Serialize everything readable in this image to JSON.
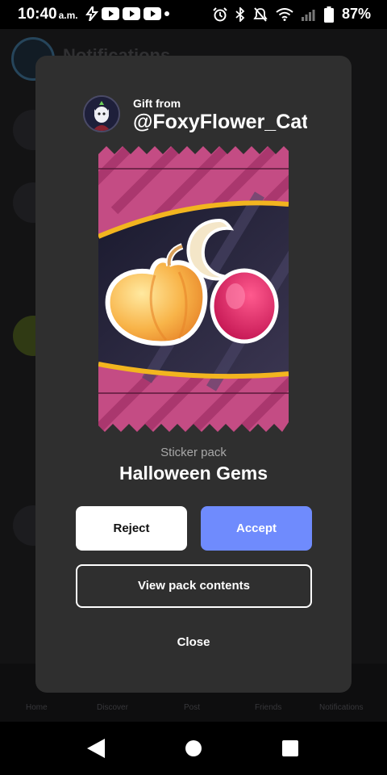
{
  "status_bar": {
    "time": "10:40",
    "ampm": "a.m.",
    "battery": "87%"
  },
  "background_app": {
    "header_title": "Notifications",
    "nav": [
      "Home",
      "Discover",
      "Post",
      "Friends",
      "Notifications"
    ]
  },
  "gift_modal": {
    "gift_from_label": "Gift from",
    "username": "@FoxyFlower_Cat",
    "pack_type": "Sticker pack",
    "pack_name": "Halloween Gems",
    "reject_label": "Reject",
    "accept_label": "Accept",
    "view_contents_label": "View pack contents",
    "close_label": "Close"
  },
  "colors": {
    "modal_bg": "#2f2f2f",
    "accept": "#6f8bfd",
    "pack_pink": "#c44c84",
    "pack_gold": "#f2b51f"
  },
  "icons": [
    "lightning-icon",
    "youtube-icon",
    "alarm-icon",
    "bluetooth-icon",
    "mute-icon",
    "wifi-icon",
    "signal-icon",
    "battery-icon",
    "back-icon",
    "home-icon",
    "recents-icon"
  ]
}
